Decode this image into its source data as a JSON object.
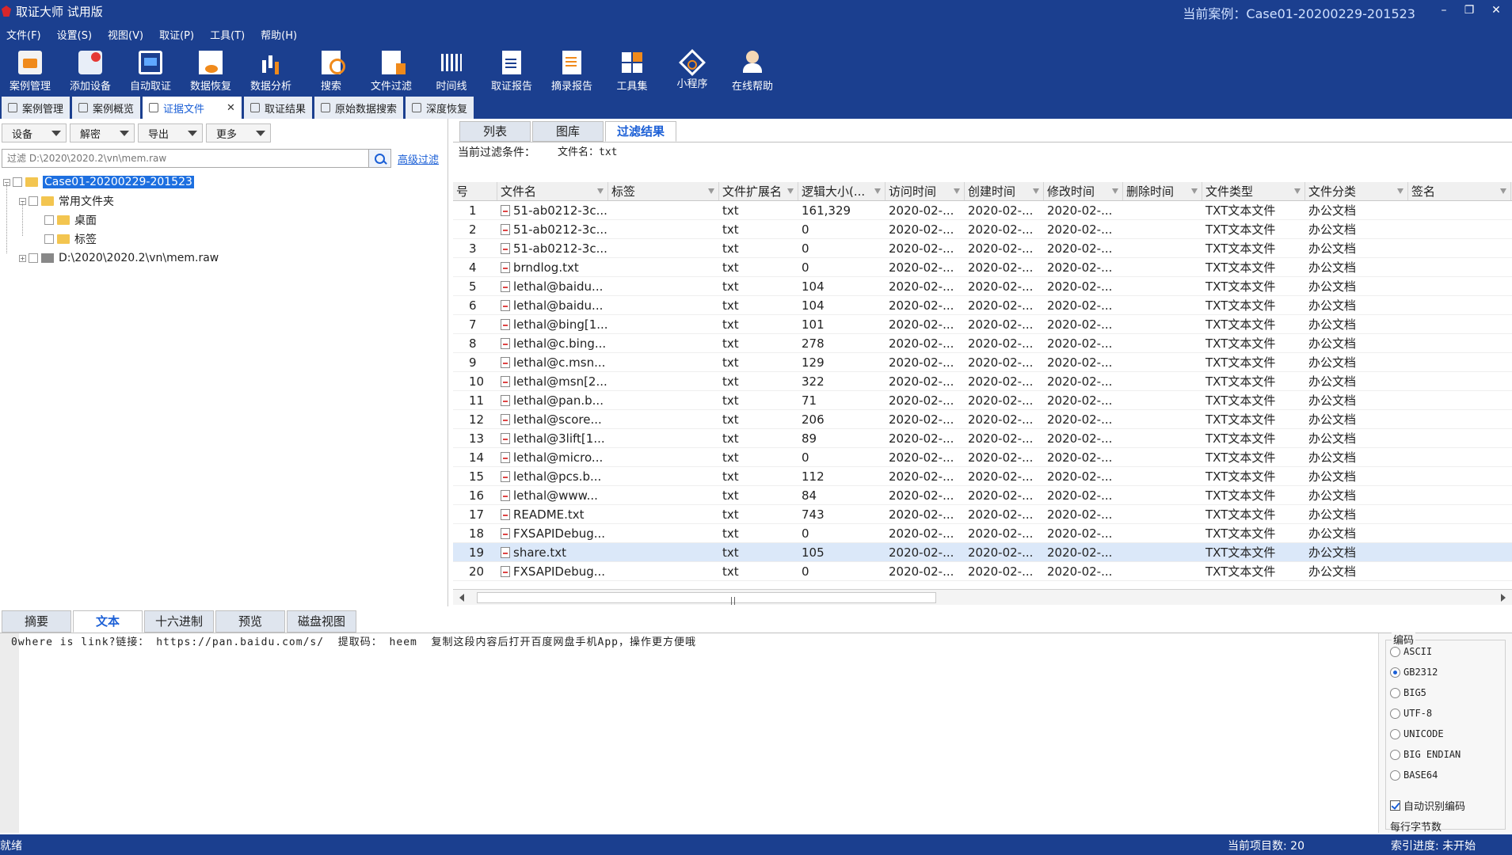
{
  "app": {
    "title": "取证大师 试用版",
    "current_case": "当前案例：Case01-20200229-201523",
    "min_glyph": "–",
    "restore_glyph": "❐",
    "close_glyph": "✕"
  },
  "menu": [
    "文件(F)",
    "设置(S)",
    "视图(V)",
    "取证(P)",
    "工具(T)",
    "帮助(H)"
  ],
  "toolbar": [
    {
      "label": "案例管理",
      "icon": "case-manage-icon"
    },
    {
      "label": "添加设备",
      "icon": "add-device-icon"
    },
    {
      "label": "自动取证",
      "icon": "auto-forensic-icon"
    },
    {
      "label": "数据恢复",
      "icon": "data-recovery-icon"
    },
    {
      "label": "数据分析",
      "icon": "data-analysis-icon"
    },
    {
      "label": "搜索",
      "icon": "search-icon"
    },
    {
      "label": "文件过滤",
      "icon": "file-filter-icon"
    },
    {
      "label": "时间线",
      "icon": "timeline-icon"
    },
    {
      "label": "取证报告",
      "icon": "forensic-report-icon"
    },
    {
      "label": "摘录报告",
      "icon": "excerpt-report-icon"
    },
    {
      "label": "工具集",
      "icon": "toolset-icon"
    },
    {
      "label": "小程序",
      "icon": "applet-icon"
    },
    {
      "label": "在线帮助",
      "icon": "online-help-icon"
    }
  ],
  "doc_tabs": [
    {
      "label": "案例管理",
      "active": false
    },
    {
      "label": "案例概览",
      "active": false
    },
    {
      "label": "证据文件",
      "active": true,
      "close": "✕"
    },
    {
      "label": "取证结果",
      "active": false
    },
    {
      "label": "原始数据搜索",
      "active": false
    },
    {
      "label": "深度恢复",
      "active": false
    }
  ],
  "left": {
    "buttons": [
      "设备",
      "解密",
      "导出",
      "更多"
    ],
    "filter_placeholder": "过滤 D:\\2020\\2020.2\\vn\\mem.raw",
    "advanced_filter": "高级过滤",
    "tree": {
      "root": "Case01-20200229-201523",
      "common_folder": "常用文件夹",
      "desktop": "桌面",
      "tags": "标签",
      "image": "D:\\2020\\2020.2\\vn\\mem.raw"
    }
  },
  "right": {
    "subtabs": [
      "列表",
      "图库",
      "过滤结果"
    ],
    "active_subtab": 2,
    "condition_label": "当前过滤条件：",
    "condition_value": "文件名：txt",
    "columns": [
      "号",
      "文件名",
      "标签",
      "文件扩展名",
      "逻辑大小(...",
      "访问时间",
      "创建时间",
      "修改时间",
      "删除时间",
      "文件类型",
      "文件分类",
      "签名"
    ],
    "rows": [
      {
        "no": "1",
        "name": "51-ab0212-3c...",
        "tag": "",
        "ext": "txt",
        "size": "161,329",
        "atime": "2020-02-...",
        "ctime": "2020-02-...",
        "mtime": "2020-02-...",
        "dtime": "",
        "type": "TXT文本文件",
        "cat": "办公文档",
        "sig": ""
      },
      {
        "no": "2",
        "name": "51-ab0212-3c...",
        "tag": "",
        "ext": "txt",
        "size": "0",
        "atime": "2020-02-...",
        "ctime": "2020-02-...",
        "mtime": "2020-02-...",
        "dtime": "",
        "type": "TXT文本文件",
        "cat": "办公文档",
        "sig": ""
      },
      {
        "no": "3",
        "name": "51-ab0212-3c...",
        "tag": "",
        "ext": "txt",
        "size": "0",
        "atime": "2020-02-...",
        "ctime": "2020-02-...",
        "mtime": "2020-02-...",
        "dtime": "",
        "type": "TXT文本文件",
        "cat": "办公文档",
        "sig": ""
      },
      {
        "no": "4",
        "name": "brndlog.txt",
        "tag": "",
        "ext": "txt",
        "size": "0",
        "atime": "2020-02-...",
        "ctime": "2020-02-...",
        "mtime": "2020-02-...",
        "dtime": "",
        "type": "TXT文本文件",
        "cat": "办公文档",
        "sig": ""
      },
      {
        "no": "5",
        "name": "lethal@baidu...",
        "tag": "",
        "ext": "txt",
        "size": "104",
        "atime": "2020-02-...",
        "ctime": "2020-02-...",
        "mtime": "2020-02-...",
        "dtime": "",
        "type": "TXT文本文件",
        "cat": "办公文档",
        "sig": ""
      },
      {
        "no": "6",
        "name": "lethal@baidu...",
        "tag": "",
        "ext": "txt",
        "size": "104",
        "atime": "2020-02-...",
        "ctime": "2020-02-...",
        "mtime": "2020-02-...",
        "dtime": "",
        "type": "TXT文本文件",
        "cat": "办公文档",
        "sig": ""
      },
      {
        "no": "7",
        "name": "lethal@bing[1...",
        "tag": "",
        "ext": "txt",
        "size": "101",
        "atime": "2020-02-...",
        "ctime": "2020-02-...",
        "mtime": "2020-02-...",
        "dtime": "",
        "type": "TXT文本文件",
        "cat": "办公文档",
        "sig": ""
      },
      {
        "no": "8",
        "name": "lethal@c.bing...",
        "tag": "",
        "ext": "txt",
        "size": "278",
        "atime": "2020-02-...",
        "ctime": "2020-02-...",
        "mtime": "2020-02-...",
        "dtime": "",
        "type": "TXT文本文件",
        "cat": "办公文档",
        "sig": ""
      },
      {
        "no": "9",
        "name": "lethal@c.msn...",
        "tag": "",
        "ext": "txt",
        "size": "129",
        "atime": "2020-02-...",
        "ctime": "2020-02-...",
        "mtime": "2020-02-...",
        "dtime": "",
        "type": "TXT文本文件",
        "cat": "办公文档",
        "sig": ""
      },
      {
        "no": "10",
        "name": "lethal@msn[2...",
        "tag": "",
        "ext": "txt",
        "size": "322",
        "atime": "2020-02-...",
        "ctime": "2020-02-...",
        "mtime": "2020-02-...",
        "dtime": "",
        "type": "TXT文本文件",
        "cat": "办公文档",
        "sig": ""
      },
      {
        "no": "11",
        "name": "lethal@pan.b...",
        "tag": "",
        "ext": "txt",
        "size": "71",
        "atime": "2020-02-...",
        "ctime": "2020-02-...",
        "mtime": "2020-02-...",
        "dtime": "",
        "type": "TXT文本文件",
        "cat": "办公文档",
        "sig": ""
      },
      {
        "no": "12",
        "name": "lethal@score...",
        "tag": "",
        "ext": "txt",
        "size": "206",
        "atime": "2020-02-...",
        "ctime": "2020-02-...",
        "mtime": "2020-02-...",
        "dtime": "",
        "type": "TXT文本文件",
        "cat": "办公文档",
        "sig": ""
      },
      {
        "no": "13",
        "name": "lethal@3lift[1...",
        "tag": "",
        "ext": "txt",
        "size": "89",
        "atime": "2020-02-...",
        "ctime": "2020-02-...",
        "mtime": "2020-02-...",
        "dtime": "",
        "type": "TXT文本文件",
        "cat": "办公文档",
        "sig": ""
      },
      {
        "no": "14",
        "name": "lethal@micro...",
        "tag": "",
        "ext": "txt",
        "size": "0",
        "atime": "2020-02-...",
        "ctime": "2020-02-...",
        "mtime": "2020-02-...",
        "dtime": "",
        "type": "TXT文本文件",
        "cat": "办公文档",
        "sig": ""
      },
      {
        "no": "15",
        "name": "lethal@pcs.b...",
        "tag": "",
        "ext": "txt",
        "size": "112",
        "atime": "2020-02-...",
        "ctime": "2020-02-...",
        "mtime": "2020-02-...",
        "dtime": "",
        "type": "TXT文本文件",
        "cat": "办公文档",
        "sig": ""
      },
      {
        "no": "16",
        "name": "lethal@www...",
        "tag": "",
        "ext": "txt",
        "size": "84",
        "atime": "2020-02-...",
        "ctime": "2020-02-...",
        "mtime": "2020-02-...",
        "dtime": "",
        "type": "TXT文本文件",
        "cat": "办公文档",
        "sig": ""
      },
      {
        "no": "17",
        "name": "README.txt",
        "tag": "",
        "ext": "txt",
        "size": "743",
        "atime": "2020-02-...",
        "ctime": "2020-02-...",
        "mtime": "2020-02-...",
        "dtime": "",
        "type": "TXT文本文件",
        "cat": "办公文档",
        "sig": ""
      },
      {
        "no": "18",
        "name": "FXSAPIDebug...",
        "tag": "",
        "ext": "txt",
        "size": "0",
        "atime": "2020-02-...",
        "ctime": "2020-02-...",
        "mtime": "2020-02-...",
        "dtime": "",
        "type": "TXT文本文件",
        "cat": "办公文档",
        "sig": ""
      },
      {
        "no": "19",
        "name": "share.txt",
        "tag": "",
        "ext": "txt",
        "size": "105",
        "atime": "2020-02-...",
        "ctime": "2020-02-...",
        "mtime": "2020-02-...",
        "dtime": "",
        "type": "TXT文本文件",
        "cat": "办公文档",
        "sig": "",
        "selected": true
      },
      {
        "no": "20",
        "name": "FXSAPIDebug...",
        "tag": "",
        "ext": "txt",
        "size": "0",
        "atime": "2020-02-...",
        "ctime": "2020-02-...",
        "mtime": "2020-02-...",
        "dtime": "",
        "type": "TXT文本文件",
        "cat": "办公文档",
        "sig": ""
      }
    ]
  },
  "bottom": {
    "tabs": [
      "摘要",
      "文本",
      "十六进制",
      "预览",
      "磁盘视图"
    ],
    "active_tab": 1,
    "text_content": "0where is link?链接： https://pan.baidu.com/s/  提取码： heem  复制这段内容后打开百度网盘手机App，操作更方便哦",
    "encoding": {
      "title": "编码",
      "options": [
        "ASCII",
        "GB2312",
        "BIG5",
        "UTF-8",
        "UNICODE",
        "BIG ENDIAN",
        "BASE64"
      ],
      "selected": "GB2312",
      "auto_detect": "自动识别编码",
      "per_line": "每行字节数"
    }
  },
  "status": {
    "left": "就绪",
    "items": "当前项目数: 20",
    "index": "索引进度: 未开始"
  }
}
